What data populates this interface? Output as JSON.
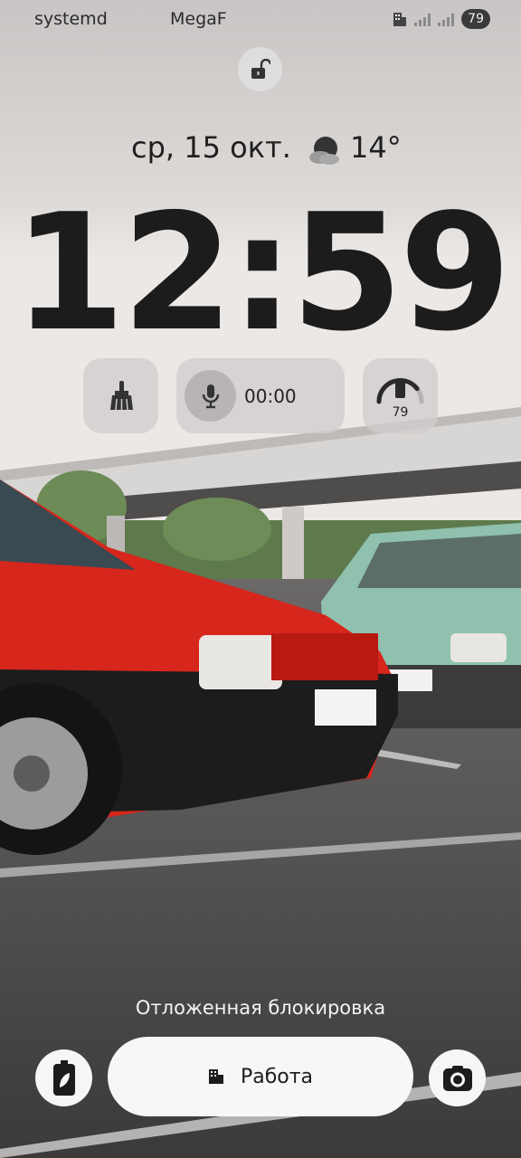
{
  "status_bar": {
    "app_left": "systemd",
    "carrier": "MegaF",
    "battery_level": "79"
  },
  "lockscreen": {
    "date": "ср, 15 окт.",
    "temperature": "14°",
    "time": "12:59"
  },
  "widgets": {
    "recorder_time": "00:00",
    "battery_gauge": "79",
    "battery_fraction": 0.79
  },
  "bottom": {
    "delay_lock_text": "Отложенная блокировка",
    "work_button_label": "Работа"
  },
  "icons": {
    "lock": "unlock-icon",
    "weather": "partly-cloudy-night-icon",
    "clean": "broom-icon",
    "mic": "microphone-icon",
    "battery_gauge": "phone-gauge-icon",
    "battery_saver": "eco-battery-icon",
    "work_building": "building-icon",
    "camera": "camera-icon"
  },
  "colors": {
    "clock": "#1c1c1c",
    "widget_bg": "#d2cdcd",
    "button_bg": "#f6f6f6",
    "car_red": "#d7261c",
    "car_teal": "#8fc1ae"
  }
}
